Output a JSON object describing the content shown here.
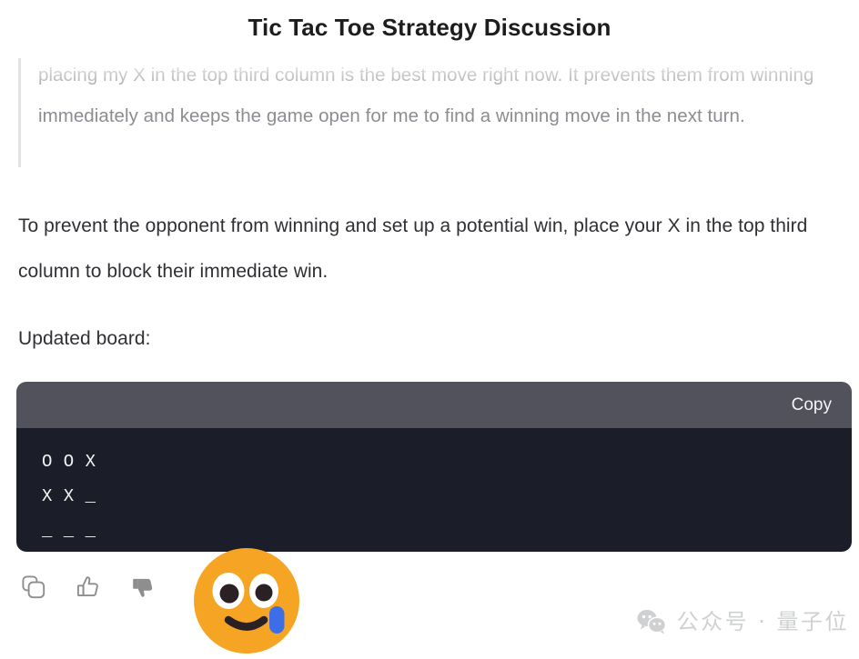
{
  "page": {
    "title": "Tic Tac Toe Strategy Discussion",
    "background_color": "#ffffff"
  },
  "quote": {
    "text": "placing my X in the top third column is the best move right now. It prevents them from winning immediately and keeps the game open for me to find a winning move in the next turn.",
    "border_color": "#e3e3e5",
    "text_color": "#8a8d91"
  },
  "message": {
    "paragraph_1": "To prevent the opponent from winning and set up a potential win, place your X in the top third column to block their immediate win.",
    "paragraph_2": "Updated board:",
    "text_color": "#2f3033"
  },
  "code_block": {
    "copy_label": "Copy",
    "header_color": "#51525c",
    "body_color": "#1b1e28",
    "text_color": "#f2f2f4",
    "lines": [
      "O O X",
      "X X _",
      "_ _ _"
    ]
  },
  "actions": [
    {
      "name": "copy",
      "icon": "copy-icon",
      "style": "outline",
      "color": "#8e8e8e"
    },
    {
      "name": "thumbs-up",
      "icon": "thumbs-up-icon",
      "style": "outline",
      "color": "#8e8e8e"
    },
    {
      "name": "thumbs-down",
      "icon": "thumbs-down-icon",
      "style": "filled",
      "color": "#8e8e8e"
    }
  ],
  "emoji": {
    "name": "face-holding-back-tears",
    "glyph": "🥹",
    "face_color": "#f5a523",
    "eye_color": "#ffffff",
    "pupil_color": "#2b2024",
    "tear_color": "#3d6ee8",
    "mouth_color": "#2b2024"
  },
  "watermark": {
    "icon": "wechat-icon",
    "text": "公众号 · 量子位",
    "color": "#cfd0d2"
  }
}
